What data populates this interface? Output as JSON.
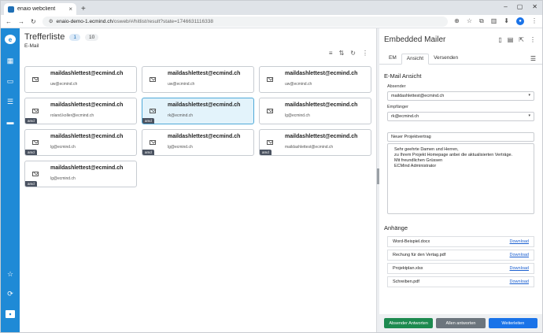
{
  "browser": {
    "tab_title": "enaio webclient",
    "url_host": "enaio-demo-1.ecmind.ch",
    "url_path": "/osweb/#/hitlist/result?state=1746631116338"
  },
  "hitlist": {
    "title": "Trefferliste",
    "count_a": "1",
    "count_b": "10",
    "subtitle": "E-Mail",
    "cards": [
      {
        "from": "maildashlettest@ecmind.ch",
        "to": "uw@ecmind.ch",
        "tag": ""
      },
      {
        "from": "maildashlettest@ecmind.ch",
        "to": "uw@ecmind.ch",
        "tag": ""
      },
      {
        "from": "maildashlettest@ecmind.ch",
        "to": "uw@ecmind.ch",
        "tag": ""
      },
      {
        "from": "maildashlettest@ecmind.ch",
        "to": "roland.koller@ecmind.ch",
        "tag": "amd"
      },
      {
        "from": "maildashlettest@ecmind.ch",
        "to": "rk@ecmind.ch",
        "tag": "amd",
        "selected": true
      },
      {
        "from": "maildashlettest@ecmind.ch",
        "to": "lg@ecmind.ch",
        "tag": ""
      },
      {
        "from": "maildashlettest@ecmind.ch",
        "to": "lg@ecmind.ch",
        "tag": "amd"
      },
      {
        "from": "maildashlettest@ecmind.ch",
        "to": "lg@ecmind.ch",
        "tag": "amd"
      },
      {
        "from": "maildashlettest@ecmind.ch",
        "to": "maildashlettest@ecmind.ch",
        "tag": "amd"
      },
      {
        "from": "maildashlettest@ecmind.ch",
        "to": "lg@ecmind.ch",
        "tag": "amd"
      }
    ]
  },
  "mailer": {
    "title": "Embedded Mailer",
    "tabs": [
      "EM",
      "Ansicht",
      "Versenden"
    ],
    "section_view": "E-Mail Ansicht",
    "sender_label": "Absender",
    "sender_value": "maildashlettest@ecmind.ch",
    "recipient_label": "Empfänger",
    "recipient_value": "rk@ecmind.ch",
    "subject": "Neuer Projektvertrag",
    "body_lines": [
      "Sehr geehrte Damen und Herren,",
      "zu Ihrem Projekt Homepage anbei die aktualisierten Verträge.",
      "Mit freundlichen Grüssen",
      "ECMind Administrator"
    ],
    "section_attachments": "Anhänge",
    "attachments": [
      {
        "name": "Word-Beispiel.docx",
        "link": "Download"
      },
      {
        "name": "Rechung für den Vertag.pdf",
        "link": "Download"
      },
      {
        "name": "Projektplan.xlsx",
        "link": "Download"
      },
      {
        "name": "Schreiben.pdf",
        "link": "Download"
      }
    ],
    "actions": {
      "reply_sender": "Absender Antworten",
      "reply_all": "Allen antworten",
      "forward": "Weiterleiten"
    }
  }
}
